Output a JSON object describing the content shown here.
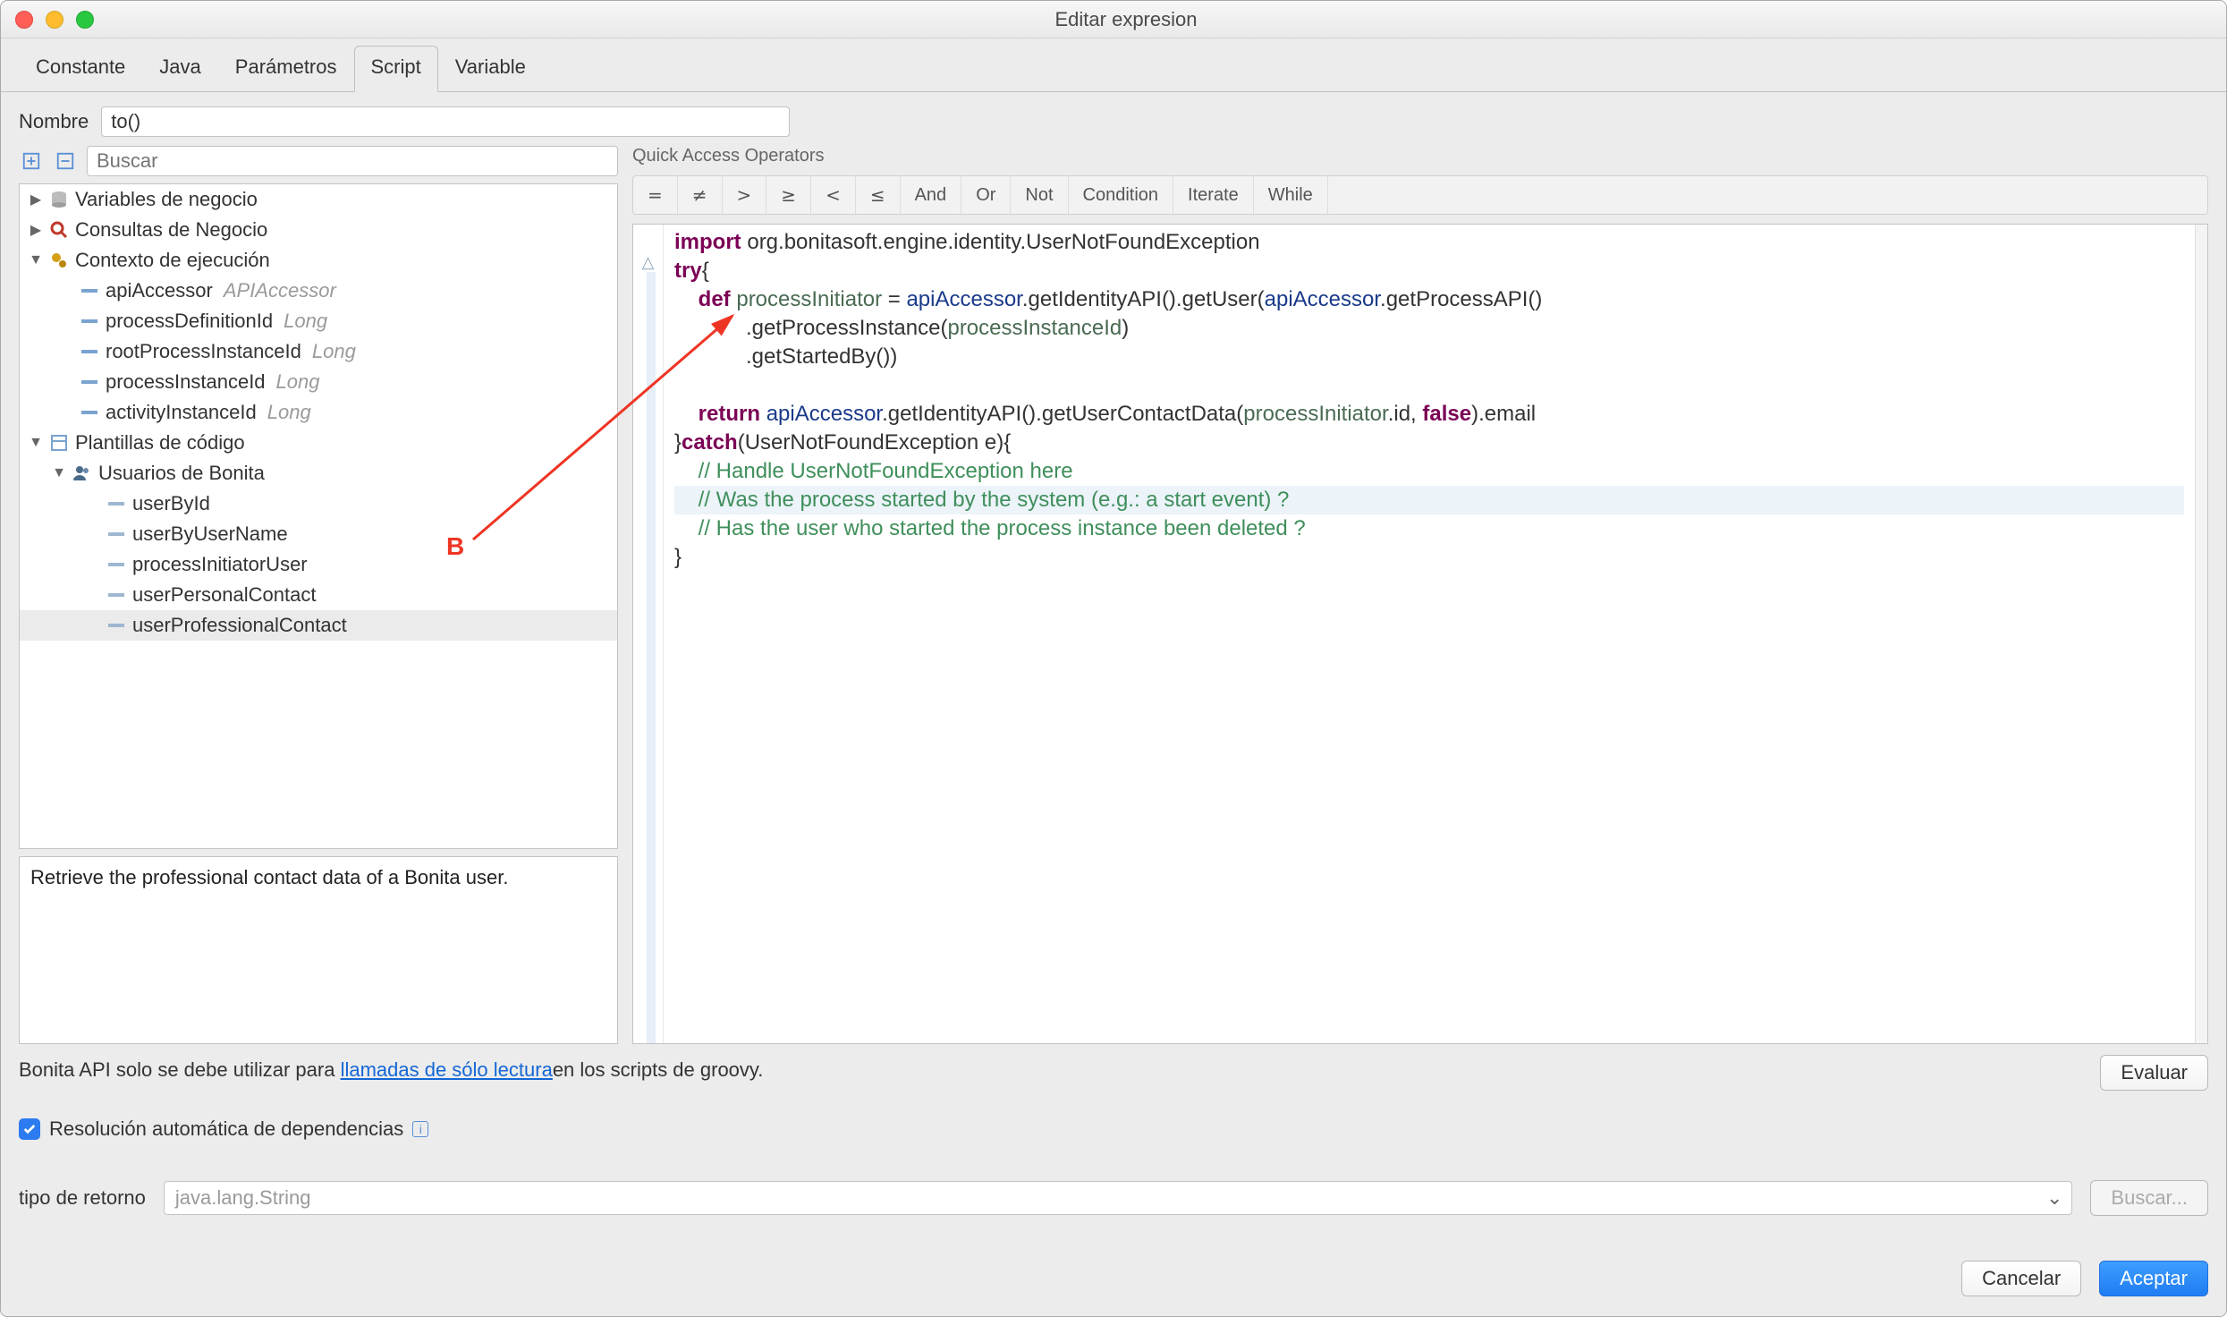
{
  "window": {
    "title": "Editar expresion"
  },
  "tabs": [
    {
      "label": "Constante",
      "active": false
    },
    {
      "label": "Java",
      "active": false
    },
    {
      "label": "Parámetros",
      "active": false
    },
    {
      "label": "Script",
      "active": true
    },
    {
      "label": "Variable",
      "active": false
    }
  ],
  "form": {
    "name_label": "Nombre",
    "name_value": "to()",
    "search_placeholder": "Buscar"
  },
  "tree": {
    "business_vars": "Variables de negocio",
    "business_queries": "Consultas de Negocio",
    "exec_context": "Contexto de ejecución",
    "ctx_items": [
      {
        "name": "apiAccessor",
        "type": "APIAccessor"
      },
      {
        "name": "processDefinitionId",
        "type": "Long"
      },
      {
        "name": "rootProcessInstanceId",
        "type": "Long"
      },
      {
        "name": "processInstanceId",
        "type": "Long"
      },
      {
        "name": "activityInstanceId",
        "type": "Long"
      }
    ],
    "code_templates": "Plantillas de código",
    "bonita_users": "Usuarios de Bonita",
    "user_items": [
      {
        "name": "userById"
      },
      {
        "name": "userByUserName"
      },
      {
        "name": "processInitiatorUser"
      },
      {
        "name": "userPersonalContact"
      },
      {
        "name": "userProfessionalContact",
        "selected": true
      }
    ]
  },
  "description": "Retrieve the professional contact data of a Bonita user.",
  "quick_access": {
    "label": "Quick Access Operators",
    "ops": [
      "=",
      "≠",
      ">",
      "≥",
      "<",
      "≤",
      "And",
      "Or",
      "Not",
      "Condition",
      "Iterate",
      "While"
    ]
  },
  "code": {
    "l1_kw": "import",
    "l1_rest": " org.bonitasoft.engine.identity.UserNotFoundException",
    "l2_kw": "try",
    "l2_rest": "{",
    "l3_kw": "def",
    "l3_var": " processInitiator",
    "l3_eq": " = ",
    "l3_api1": "apiAccessor",
    "l3_mid1": ".getIdentityAPI().getUser(",
    "l3_api2": "apiAccessor",
    "l3_mid2": ".getProcessAPI()",
    "l4": "            .getProcessInstance(",
    "l4_var": "processInstanceId",
    "l4_end": ")",
    "l5": "            .getStartedBy())",
    "l7_kw": "return",
    "l7_sp": " ",
    "l7_api": "apiAccessor",
    "l7_mid": ".getIdentityAPI().getUserContactData(",
    "l7_var": "processInitiator",
    "l7_mid2": ".id, ",
    "l7_false": "false",
    "l7_end": ").email",
    "l8a": "}",
    "l8_kw": "catch",
    "l8_rest": "(UserNotFoundException e){",
    "l9": "    // Handle UserNotFoundException here",
    "l10": "    // Was the process started by the system (e.g.: a start event) ?",
    "l11": "    // Has the user who started the process instance been deleted ?",
    "l12": "}"
  },
  "footer": {
    "api_notice_pre": "Bonita API solo se debe utilizar para ",
    "api_notice_link": "llamadas de sólo lectura",
    "api_notice_post": "en los scripts de groovy.",
    "evaluate": "Evaluar",
    "checkbox_label": "Resolución automática de dependencias",
    "return_type_label": "tipo de retorno",
    "return_type_value": "java.lang.String",
    "browse": "Buscar...",
    "cancel": "Cancelar",
    "accept": "Aceptar"
  },
  "annotation": {
    "b": "B"
  }
}
